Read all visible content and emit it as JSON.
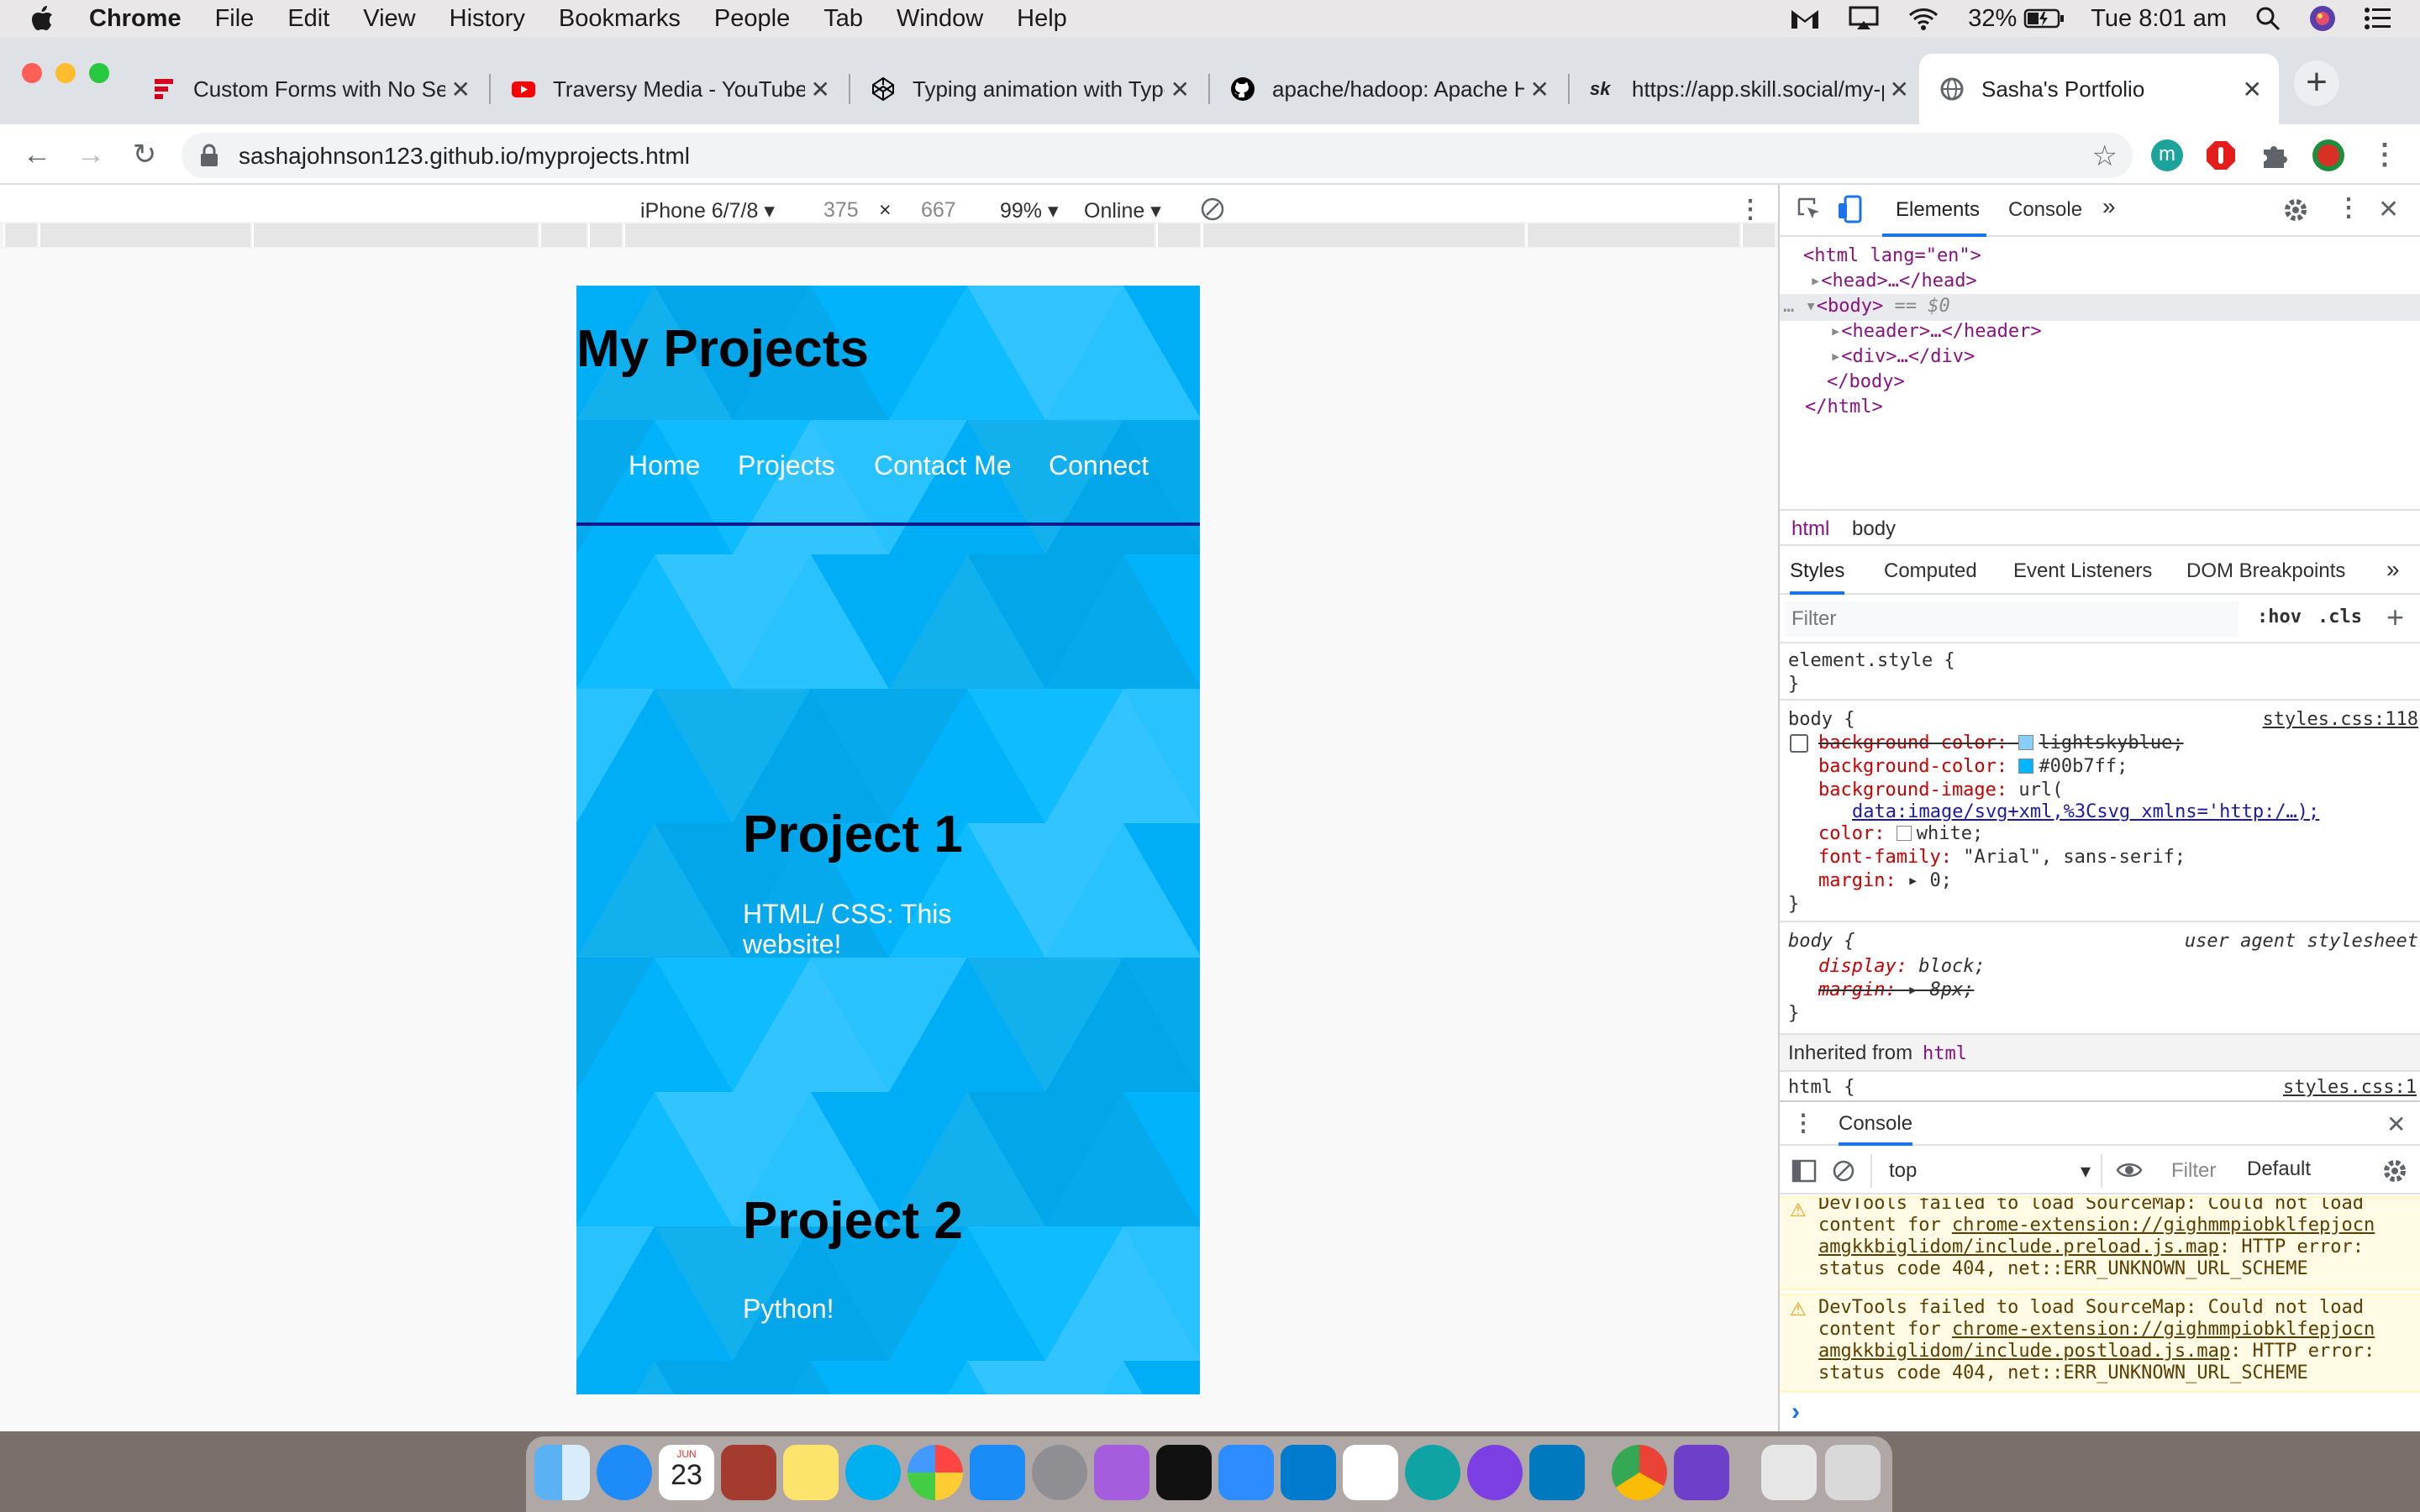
{
  "menubar": {
    "app": "Chrome",
    "items": [
      "File",
      "Edit",
      "View",
      "History",
      "Bookmarks",
      "People",
      "Tab",
      "Window",
      "Help"
    ],
    "battery": "32%",
    "clock": "Tue 8:01 am"
  },
  "tabs": [
    {
      "title": "Custom Forms with No Server",
      "favicon": "forms-icon",
      "color": "#d6001c"
    },
    {
      "title": "Traversy Media - YouTube",
      "favicon": "youtube-icon",
      "color": "#ff0000"
    },
    {
      "title": "Typing animation with Typed.js",
      "favicon": "codepen-icon",
      "color": "#000000"
    },
    {
      "title": "apache/hadoop: Apache Hadoop",
      "favicon": "github-icon",
      "color": "#000000"
    },
    {
      "title": "https://app.skill.social/my-profile",
      "favicon": "skill-social-icon",
      "color": "#000000"
    },
    {
      "title": "Sasha's Portfolio",
      "favicon": "globe-icon",
      "color": "#5f6368",
      "active": true
    }
  ],
  "address_bar": {
    "url": "sashajohnson123.github.io/myprojects.html"
  },
  "device_toolbar": {
    "device": "iPhone 6/7/8",
    "width": "375",
    "height": "667",
    "times": "×",
    "zoom": "99%",
    "throttle": "Online"
  },
  "page": {
    "title": "My Projects",
    "nav": [
      "Home",
      "Projects",
      "Contact Me",
      "Connect"
    ],
    "projects": [
      {
        "title": "Project 1",
        "desc": "HTML/ CSS: This website!"
      },
      {
        "title": "Project 2",
        "desc": "Python!"
      }
    ]
  },
  "devtools": {
    "tabs": [
      "Elements",
      "Console"
    ],
    "dom": {
      "html_open": "<html lang=\"en\">",
      "head": "<head>…</head>",
      "body_open": "<body>",
      "body_sel": "== $0",
      "header": "<header>…</header>",
      "div": "<div>…</div>",
      "body_close": "</body>",
      "html_close": "</html>"
    },
    "breadcrumbs": [
      "html",
      "body"
    ],
    "styles_tabs": [
      "Styles",
      "Computed",
      "Event Listeners",
      "DOM Breakpoints"
    ],
    "filter_placeholder": "Filter",
    "hov": ":hov",
    "cls": ".cls",
    "element_style": "element.style {",
    "close_brace": "}",
    "body_rule": {
      "selector": "body {",
      "source": "styles.css:118",
      "decls": [
        {
          "prop": "background-color:",
          "val": "lightskyblue;",
          "struck": true,
          "swatch": "#87cefa"
        },
        {
          "prop": "background-color:",
          "val": "#00b7ff;",
          "swatch": "#00b7ff"
        },
        {
          "prop": "background-image:",
          "val": "url("
        },
        {
          "prop": "",
          "val": "data:image/svg+xml,%3Csvg xmlns='http:/…);"
        },
        {
          "prop": "color:",
          "val": "white;",
          "swatch": "#ffffff"
        },
        {
          "prop": "font-family:",
          "val": "\"Arial\", sans-serif;"
        },
        {
          "prop": "margin:",
          "val": "▸ 0;"
        }
      ]
    },
    "ua_rule": {
      "selector": "body {",
      "source": "user agent stylesheet",
      "decls": [
        {
          "prop": "display:",
          "val": "block;"
        },
        {
          "prop": "margin:",
          "val": "▸ 8px;",
          "struck": true
        }
      ]
    },
    "inherited": "Inherited from",
    "inherited_tag": "html",
    "html_rule": {
      "selector": "html {",
      "source": "styles.css:1"
    },
    "drawer": {
      "title": "Console",
      "context": "top",
      "filter": "Filter",
      "level": "Default",
      "messages": [
        {
          "l1": "DevTools failed to load SourceMap: Could not load",
          "l2": "content for ",
          "link1": "chrome-extension://gighmmpiobklfepjocn",
          "link2": "amgkkbiglidom/include.preload.js.map",
          "l3": ": HTTP error:",
          "l4": "status code 404, net::ERR_UNKNOWN_URL_SCHEME"
        },
        {
          "l1": "DevTools failed to load SourceMap: Could not load",
          "l2": "content for ",
          "link1": "chrome-extension://gighmmpiobklfepjocn",
          "link2": "amgkkbiglidom/include.postload.js.map",
          "l3": ": HTTP error:",
          "l4": "status code 404, net::ERR_UNKNOWN_URL_SCHEME"
        }
      ],
      "prompt": "›"
    }
  },
  "dock": {
    "apps": [
      "finder-icon",
      "safari-icon",
      "calendar-icon",
      "dictionary-icon",
      "notes-icon",
      "skype-icon",
      "photos-icon",
      "app-store-icon",
      "system-preferences-icon",
      "podcasts-icon",
      "apple-tv-icon",
      "zoom-icon",
      "vscode-icon",
      "slack-icon",
      "notion-like-icon",
      "idea-icon",
      "trello-icon",
      "chrome-icon",
      "github-desktop-icon",
      "downloads-icon",
      "trash-icon"
    ],
    "calendar_month": "JUN",
    "calendar_day": "23"
  }
}
